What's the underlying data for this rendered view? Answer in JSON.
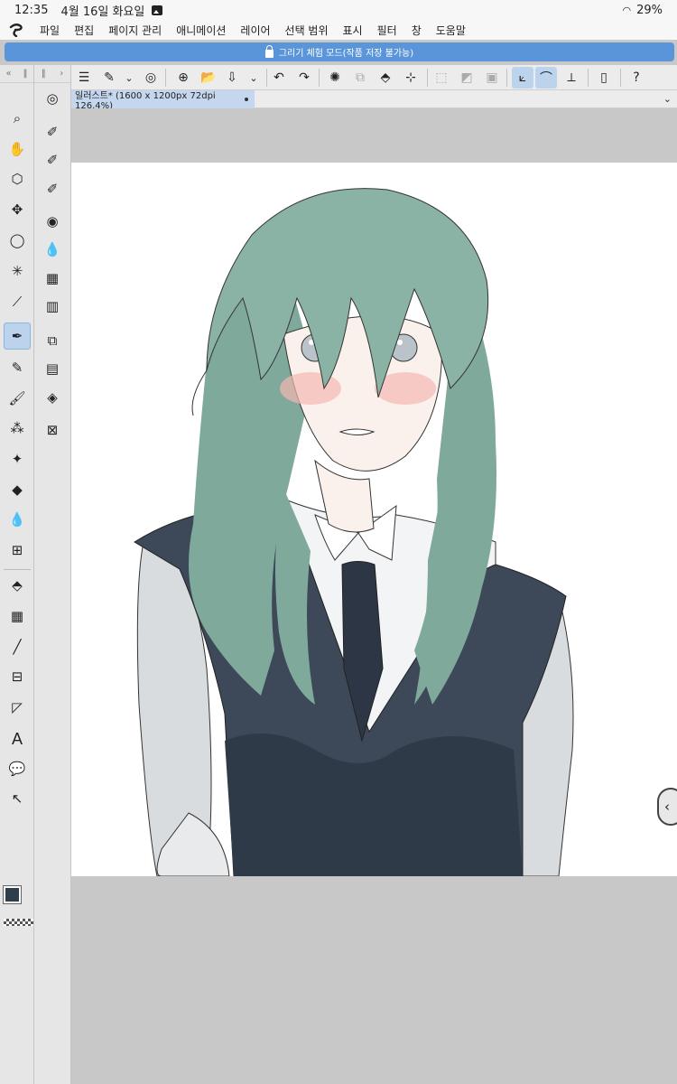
{
  "status": {
    "time": "12:35",
    "date": "4월 16일 화요일",
    "battery": "29%"
  },
  "menu": [
    "파일",
    "편집",
    "페이지 관리",
    "애니메이션",
    "레이어",
    "선택 범위",
    "표시",
    "필터",
    "창",
    "도움말"
  ],
  "banner": {
    "text": "그리기 체험 모드(작품 저장 불가능)"
  },
  "tab": {
    "title": "일러스트* (1600 x 1200px 72dpi 126.4%)"
  },
  "tool_icons": [
    "zoom-icon",
    "hand-icon",
    "object-icon",
    "move-icon",
    "lasso-icon",
    "magic-wand-icon",
    "eyedropper-icon",
    "pen-icon",
    "pencil-icon",
    "brush-icon",
    "airbrush-icon",
    "decoration-icon",
    "eraser-icon",
    "blend-icon",
    "mesh-transform-icon",
    "fill-icon",
    "gradient-icon",
    "line-icon",
    "frame-icon",
    "ruler-icon",
    "text-icon",
    "balloon-icon",
    "correct-line-icon"
  ],
  "colors": {
    "main_color": "#2e3e4c",
    "sub_color": "#ffffff",
    "accent": "#5b95d9"
  }
}
